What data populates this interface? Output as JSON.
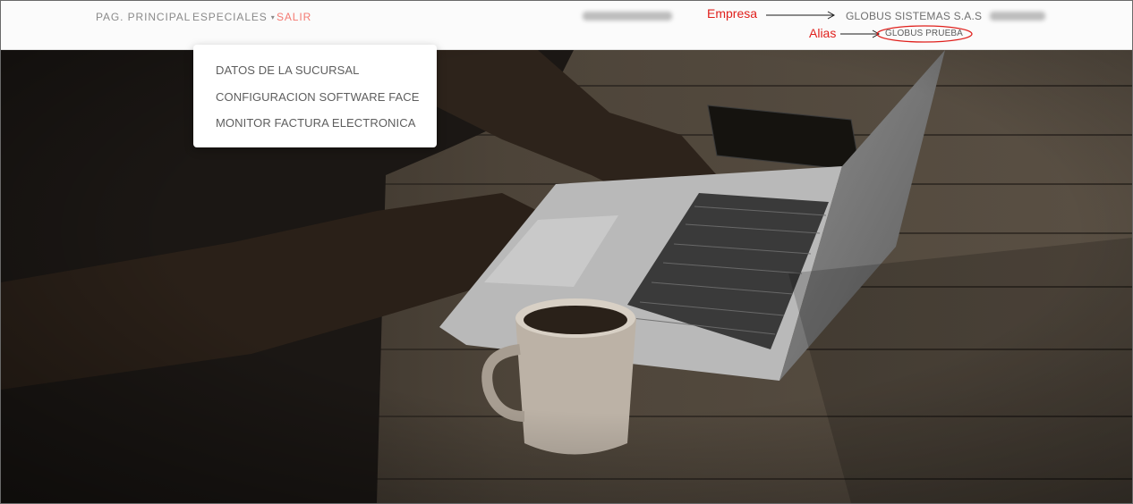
{
  "nav": {
    "home": "PAG. PRINCIPAL",
    "especiales": "ESPECIALES",
    "salir": "SALIR"
  },
  "dropdown": {
    "items": [
      "DATOS DE LA SUCURSAL",
      "CONFIGURACION SOFTWARE FACE",
      "MONITOR FACTURA ELECTRONICA"
    ]
  },
  "annotations": {
    "empresa_label": "Empresa",
    "alias_label": "Alias"
  },
  "company": {
    "name": "GLOBUS SISTEMAS S.A.S",
    "alias": "GLOBUS PRUEBA"
  },
  "icons": {
    "dropdown_caret": "chevron-down-icon"
  },
  "colors": {
    "salir": "#f47a72",
    "annotation": "#e0201c",
    "nav_text": "#8a8a8a"
  }
}
